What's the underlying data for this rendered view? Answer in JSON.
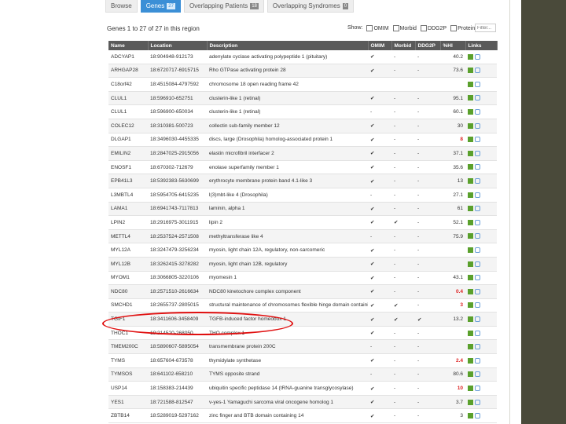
{
  "tabs": [
    {
      "label": "Browse",
      "badge": "",
      "active": false
    },
    {
      "label": "Genes",
      "badge": "27",
      "active": true
    },
    {
      "label": "Overlapping Patients",
      "badge": "18",
      "active": false
    },
    {
      "label": "Overlapping Syndromes",
      "badge": "0",
      "active": false
    }
  ],
  "summary": "Genes 1 to 27 of 27 in this region",
  "filters": {
    "label": "Show:",
    "items": [
      "OMIM",
      "Morbid",
      "DDG2P",
      "Protein coding"
    ]
  },
  "filter_placeholder": "Filter...",
  "columns": [
    "Name",
    "Location",
    "Description",
    "OMIM",
    "Morbid",
    "DDG2P",
    "%HI",
    "Links"
  ],
  "rows": [
    {
      "name": "ADCYAP1",
      "loc": "18:904948-912173",
      "desc": "adenylate cyclase activating polypeptide 1 (pituitary)",
      "omim": "✔",
      "morbid": "-",
      "ddg2p": "-",
      "hi": "40.2",
      "red": false
    },
    {
      "name": "ARHGAP28",
      "loc": "18:6720717-6915715",
      "desc": "Rho GTPase activating protein 28",
      "omim": "✔",
      "morbid": "-",
      "ddg2p": "-",
      "hi": "73.6",
      "red": false
    },
    {
      "name": "C18orf42",
      "loc": "18:4515084-4797592",
      "desc": "chromosome 18 open reading frame 42",
      "omim": "",
      "morbid": "",
      "ddg2p": "",
      "hi": "",
      "red": false
    },
    {
      "name": "CLUL1",
      "loc": "18:596910-652751",
      "desc": "clusterin-like 1 (retinal)",
      "omim": "✔",
      "morbid": "-",
      "ddg2p": "-",
      "hi": "95.1",
      "red": false
    },
    {
      "name": "CLUL1",
      "loc": "18:596900-650034",
      "desc": "clusterin-like 1 (retinal)",
      "omim": "-",
      "morbid": "-",
      "ddg2p": "-",
      "hi": "60.1",
      "red": false
    },
    {
      "name": "COLEC12",
      "loc": "18:310381-500723",
      "desc": "collectin sub-family member 12",
      "omim": "✔",
      "morbid": "-",
      "ddg2p": "-",
      "hi": "30",
      "red": false
    },
    {
      "name": "DLGAP1",
      "loc": "18:3496030-4455335",
      "desc": "discs, large (Drosophila) homolog-associated protein 1",
      "omim": "✔",
      "morbid": "-",
      "ddg2p": "-",
      "hi": "8",
      "red": true
    },
    {
      "name": "EMILIN2",
      "loc": "18:2847025-2915056",
      "desc": "elastin microfibril interfacer 2",
      "omim": "✔",
      "morbid": "-",
      "ddg2p": "-",
      "hi": "37.1",
      "red": false
    },
    {
      "name": "ENOSF1",
      "loc": "18:670302-712679",
      "desc": "enolase superfamily member 1",
      "omim": "✔",
      "morbid": "-",
      "ddg2p": "-",
      "hi": "35.6",
      "red": false
    },
    {
      "name": "EPB41L3",
      "loc": "18:5392383-5630699",
      "desc": "erythrocyte membrane protein band 4.1-like 3",
      "omim": "✔",
      "morbid": "-",
      "ddg2p": "-",
      "hi": "13",
      "red": false
    },
    {
      "name": "L3MBTL4",
      "loc": "18:5954705-6415235",
      "desc": "l(3)mbt-like 4 (Drosophila)",
      "omim": "-",
      "morbid": "-",
      "ddg2p": "-",
      "hi": "27.1",
      "red": false
    },
    {
      "name": "LAMA1",
      "loc": "18:6941743-7117813",
      "desc": "laminin, alpha 1",
      "omim": "✔",
      "morbid": "-",
      "ddg2p": "-",
      "hi": "61",
      "red": false
    },
    {
      "name": "LPIN2",
      "loc": "18:2916975-3011915",
      "desc": "lipin 2",
      "omim": "✔",
      "morbid": "✔",
      "ddg2p": "-",
      "hi": "52.1",
      "red": false
    },
    {
      "name": "METTL4",
      "loc": "18:2537524-2571508",
      "desc": "methyltransferase like 4",
      "omim": "-",
      "morbid": "-",
      "ddg2p": "-",
      "hi": "75.9",
      "red": false
    },
    {
      "name": "MYL12A",
      "loc": "18:3247479-3256234",
      "desc": "myosin, light chain 12A, regulatory, non-sarcomeric",
      "omim": "✔",
      "morbid": "-",
      "ddg2p": "-",
      "hi": "",
      "red": false
    },
    {
      "name": "MYL12B",
      "loc": "18:3262415-3278282",
      "desc": "myosin, light chain 12B, regulatory",
      "omim": "✔",
      "morbid": "-",
      "ddg2p": "-",
      "hi": "",
      "red": false
    },
    {
      "name": "MYOM1",
      "loc": "18:3066805-3220106",
      "desc": "myomesin 1",
      "omim": "✔",
      "morbid": "-",
      "ddg2p": "-",
      "hi": "43.1",
      "red": false
    },
    {
      "name": "NDC80",
      "loc": "18:2571510-2616634",
      "desc": "NDC80 kinetochore complex component",
      "omim": "✔",
      "morbid": "-",
      "ddg2p": "-",
      "hi": "0.4",
      "red": true
    },
    {
      "name": "SMCHD1",
      "loc": "18:2655737-2805015",
      "desc": "structural maintenance of chromosomes flexible hinge domain containing 1",
      "omim": "✔",
      "morbid": "✔",
      "ddg2p": "-",
      "hi": "3",
      "red": true
    },
    {
      "name": "TGIF1",
      "loc": "18:3411606-3458409",
      "desc": "TGFB-induced factor homeobox 1",
      "omim": "✔",
      "morbid": "✔",
      "ddg2p": "✔",
      "hi": "13.2",
      "red": false
    },
    {
      "name": "THOC1",
      "loc": "18:214520-268050",
      "desc": "THO complex 1",
      "omim": "✔",
      "morbid": "-",
      "ddg2p": "-",
      "hi": "",
      "red": false
    },
    {
      "name": "TMEM200C",
      "loc": "18:5890607-5895054",
      "desc": "transmembrane protein 200C",
      "omim": "-",
      "morbid": "-",
      "ddg2p": "-",
      "hi": "",
      "red": false
    },
    {
      "name": "TYMS",
      "loc": "18:657604-673578",
      "desc": "thymidylate synthetase",
      "omim": "✔",
      "morbid": "-",
      "ddg2p": "-",
      "hi": "2.4",
      "red": true
    },
    {
      "name": "TYMSOS",
      "loc": "18:641102-658210",
      "desc": "TYMS opposite strand",
      "omim": "-",
      "morbid": "-",
      "ddg2p": "-",
      "hi": "80.6",
      "red": false
    },
    {
      "name": "USP14",
      "loc": "18:158383-214439",
      "desc": "ubiquitin specific peptidase 14 (tRNA-guanine transglycosylase)",
      "omim": "✔",
      "morbid": "-",
      "ddg2p": "-",
      "hi": "10",
      "red": true
    },
    {
      "name": "YES1",
      "loc": "18:721588-812547",
      "desc": "v-yes-1 Yamaguchi sarcoma viral oncogene homolog 1",
      "omim": "✔",
      "morbid": "-",
      "ddg2p": "-",
      "hi": "3.7",
      "red": false
    },
    {
      "name": "ZBTB14",
      "loc": "18:5289019-5297162",
      "desc": "zinc finger and BTB domain containing 14",
      "omim": "✔",
      "morbid": "-",
      "ddg2p": "-",
      "hi": "3",
      "red": false
    }
  ]
}
